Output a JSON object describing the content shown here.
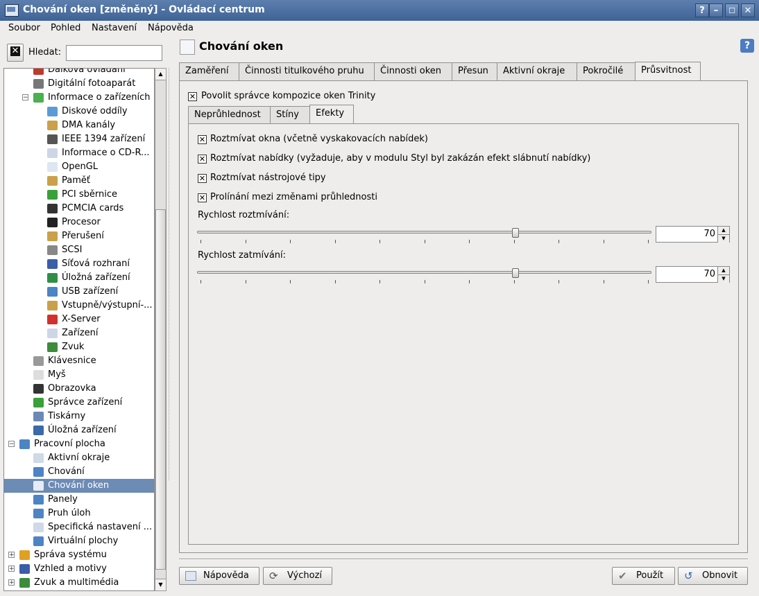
{
  "window": {
    "title": "Chování oken [změněný] - Ovládací centrum"
  },
  "menu": [
    "Soubor",
    "Pohled",
    "Nastavení",
    "Nápověda"
  ],
  "search": {
    "label": "Hledat:",
    "value": ""
  },
  "tree": [
    {
      "label": "Dálková ovládání",
      "level": 2,
      "icon": "remote-icon",
      "color": "#c0392b"
    },
    {
      "label": "Digitální fotoaparát",
      "level": 2,
      "icon": "camera-icon",
      "color": "#777"
    },
    {
      "label": "Informace o zařízeních",
      "level": 2,
      "icon": "device-info-icon",
      "color": "#4caf50",
      "exp": "-"
    },
    {
      "label": "Diskové oddíly",
      "level": 3,
      "icon": "disk-partition-icon",
      "color": "#5b9bd5"
    },
    {
      "label": "DMA kanály",
      "level": 3,
      "icon": "dma-icon",
      "color": "#caa14a"
    },
    {
      "label": "IEEE 1394 zařízení",
      "level": 3,
      "icon": "firewire-icon",
      "color": "#555"
    },
    {
      "label": "Informace o CD-R...",
      "level": 3,
      "icon": "cdrom-icon",
      "color": "#cdd6e6"
    },
    {
      "label": "OpenGL",
      "level": 3,
      "icon": "opengl-icon",
      "color": "#dfe6f2"
    },
    {
      "label": "Paměť",
      "level": 3,
      "icon": "memory-icon",
      "color": "#caa14a"
    },
    {
      "label": "PCI sběrnice",
      "level": 3,
      "icon": "pci-icon",
      "color": "#3aa03a"
    },
    {
      "label": "PCMCIA cards",
      "level": 3,
      "icon": "pcmcia-icon",
      "color": "#333"
    },
    {
      "label": "Procesor",
      "level": 3,
      "icon": "cpu-icon",
      "color": "#222"
    },
    {
      "label": "Přerušení",
      "level": 3,
      "icon": "interrupt-icon",
      "color": "#caa14a"
    },
    {
      "label": "SCSI",
      "level": 3,
      "icon": "scsi-icon",
      "color": "#888"
    },
    {
      "label": "Síťová rozhraní",
      "level": 3,
      "icon": "network-icon",
      "color": "#3a5ea8"
    },
    {
      "label": "Úložná zařízení",
      "level": 3,
      "icon": "storage-icon",
      "color": "#2f8f46"
    },
    {
      "label": "USB zařízení",
      "level": 3,
      "icon": "usb-icon",
      "color": "#4d84c4"
    },
    {
      "label": "Vstupně/výstupní-...",
      "level": 3,
      "icon": "io-icon",
      "color": "#caa14a"
    },
    {
      "label": "X-Server",
      "level": 3,
      "icon": "xserver-icon",
      "color": "#d0312d"
    },
    {
      "label": "Zařízení",
      "level": 3,
      "icon": "devices-icon",
      "color": "#cdd6e6"
    },
    {
      "label": "Zvuk",
      "level": 3,
      "icon": "sound-icon",
      "color": "#3c8c3c"
    },
    {
      "label": "Klávesnice",
      "level": 2,
      "icon": "keyboard-icon",
      "color": "#999"
    },
    {
      "label": "Myš",
      "level": 2,
      "icon": "mouse-icon",
      "color": "#ddd"
    },
    {
      "label": "Obrazovka",
      "level": 2,
      "icon": "display-icon",
      "color": "#333"
    },
    {
      "label": "Správce zařízení",
      "level": 2,
      "icon": "device-manager-icon",
      "color": "#3aa03a"
    },
    {
      "label": "Tiskárny",
      "level": 2,
      "icon": "printer-icon",
      "color": "#6a8ab5"
    },
    {
      "label": "Úložná zařízení",
      "level": 2,
      "icon": "storage-icon",
      "color": "#3a6aa8"
    },
    {
      "label": "Pracovní plocha",
      "level": 1,
      "icon": "desktop-icon",
      "color": "#4d84c4",
      "exp": "-"
    },
    {
      "label": "Aktivní okraje",
      "level": 2,
      "icon": "active-edges-icon",
      "color": "#cfd9e8"
    },
    {
      "label": "Chování",
      "level": 2,
      "icon": "behavior-icon",
      "color": "#4d84c4"
    },
    {
      "label": "Chování oken",
      "level": 2,
      "icon": "window-behavior-icon",
      "color": "#e6ecf5",
      "selected": true
    },
    {
      "label": "Panely",
      "level": 2,
      "icon": "panels-icon",
      "color": "#4d84c4"
    },
    {
      "label": "Pruh úloh",
      "level": 2,
      "icon": "taskbar-icon",
      "color": "#4d84c4"
    },
    {
      "label": "Specifická nastavení ...",
      "level": 2,
      "icon": "window-specific-icon",
      "color": "#cfd9e8"
    },
    {
      "label": "Virtuální plochy",
      "level": 2,
      "icon": "virtual-desktops-icon",
      "color": "#4d84c4"
    },
    {
      "label": "Správa systému",
      "level": 1,
      "icon": "system-admin-icon",
      "color": "#e0a020",
      "exp": "+"
    },
    {
      "label": "Vzhled a motivy",
      "level": 1,
      "icon": "appearance-icon",
      "color": "#3a5ea8",
      "exp": "+"
    },
    {
      "label": "Zvuk a multimédia",
      "level": 1,
      "icon": "multimedia-icon",
      "color": "#3c8c3c",
      "exp": "+"
    }
  ],
  "header": {
    "title": "Chování oken"
  },
  "tabs": [
    "Zaměření",
    "Činnosti titulkového pruhu",
    "Činnosti oken",
    "Přesun",
    "Aktivní okraje",
    "Pokročilé",
    "Průsvitnost"
  ],
  "active_tab": "Průsvitnost",
  "composite": {
    "label": "Povolit správce kompozice oken Trinity",
    "checked": true
  },
  "subtabs": [
    "Neprůhlednost",
    "Stíny",
    "Efekty"
  ],
  "active_subtab": "Efekty",
  "effects": [
    {
      "label": "Roztmívat okna (včetně vyskakovacích nabídek)",
      "checked": true
    },
    {
      "label": "Roztmívat nabídky (vyžaduje, aby v modulu Styl byl zakázán efekt slábnutí nabídky)",
      "checked": true
    },
    {
      "label": "Roztmívat nástrojové tipy",
      "checked": true
    },
    {
      "label": "Prolínání mezi změnami průhlednosti",
      "checked": true
    }
  ],
  "fade_in": {
    "label": "Rychlost roztmívání:",
    "value": "70",
    "level": 70
  },
  "fade_out": {
    "label": "Rychlost zatmívání:",
    "value": "70",
    "level": 70
  },
  "buttons": {
    "help": "Nápověda",
    "defaults": "Výchozí",
    "apply": "Použít",
    "reset": "Obnovit"
  }
}
